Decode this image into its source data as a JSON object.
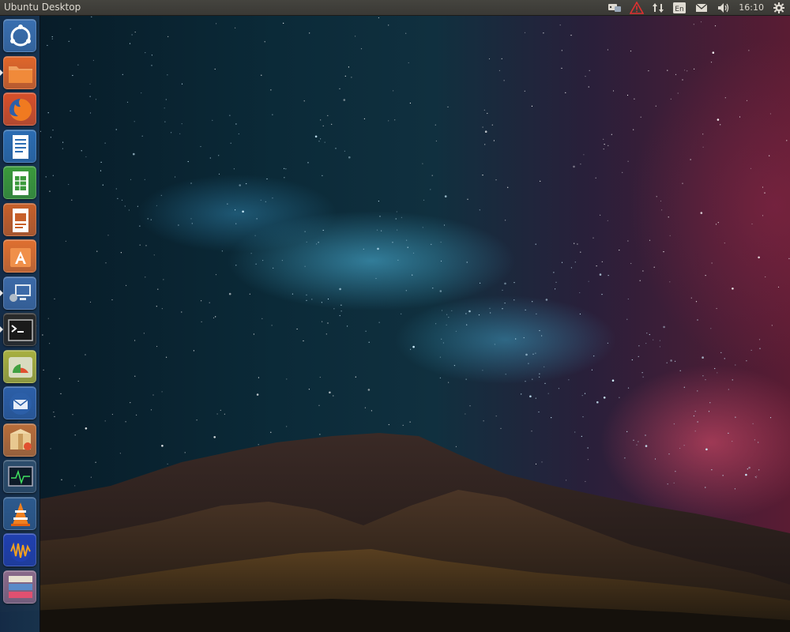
{
  "panel": {
    "window_title": "Ubuntu Desktop",
    "keyboard_layout": "En",
    "clock": "16:10"
  },
  "indicators": [
    {
      "icon": "messaging-tray-icon"
    },
    {
      "icon": "update-warning-icon",
      "color": "#e03030"
    },
    {
      "icon": "network-updown-icon"
    },
    {
      "icon": "keyboard-layout-icon"
    },
    {
      "icon": "mail-icon"
    },
    {
      "icon": "volume-icon"
    },
    {
      "icon": "clock"
    },
    {
      "icon": "session-gear-icon"
    }
  ],
  "launcher": {
    "items": [
      {
        "icon": "dash-home-icon",
        "color": "#3a6fb0"
      },
      {
        "icon": "files-folder-icon",
        "color": "#e0662a",
        "running": true
      },
      {
        "icon": "firefox-icon",
        "color": "#d9502a"
      },
      {
        "icon": "writer-document-icon",
        "color": "#2c6db3"
      },
      {
        "icon": "calc-spreadsheet-icon",
        "color": "#3b9a3b"
      },
      {
        "icon": "impress-presentation-icon",
        "color": "#c8602a"
      },
      {
        "icon": "software-center-icon",
        "color": "#e07030"
      },
      {
        "icon": "remote-desktop-icon",
        "color": "#3c6aa8",
        "running": true
      },
      {
        "icon": "terminal-icon",
        "color": "#2a2a2a",
        "running": true
      },
      {
        "icon": "disk-usage-icon",
        "color": "#a8b040"
      },
      {
        "icon": "thunderbird-icon",
        "color": "#2c5fa8"
      },
      {
        "icon": "package-installer-icon",
        "color": "#b86d3a"
      },
      {
        "icon": "system-monitor-icon",
        "color": "#2d4d6c"
      },
      {
        "icon": "vlc-icon",
        "color": "#2d5a8e"
      },
      {
        "icon": "audacity-icon",
        "color": "#2040b0"
      },
      {
        "icon": "stacked-apps-icon",
        "color": "#8a6a8a"
      }
    ]
  },
  "colors": {
    "panel_bg": "#3c3b37",
    "launcher_bg": "#1e3a5c",
    "sky_teal": "#4fb8e0",
    "sky_pink": "#e0506e"
  }
}
